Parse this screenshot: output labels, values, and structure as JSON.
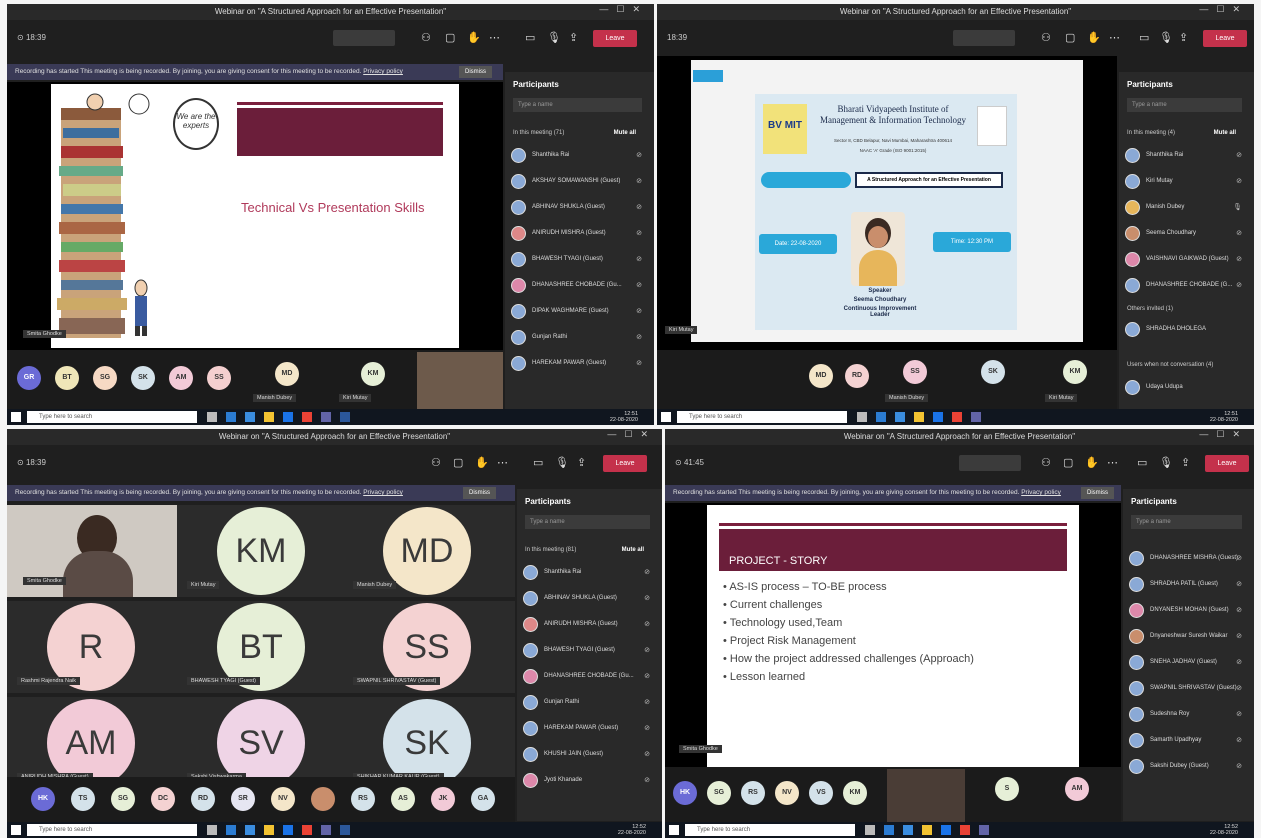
{
  "window_title": "Webinar on \"A Structured Approach for an Effective Presentation\"",
  "toolbar": {
    "leave_label": "Leave",
    "q2_time": "18:39"
  },
  "banner": {
    "text": "Recording has started  This meeting is being recorded. By joining, you are giving consent for this meeting to be recorded.",
    "privacy": "Privacy policy",
    "dismiss": "Dismiss"
  },
  "panel": {
    "title": "Participants",
    "search_placeholder": "Type a name",
    "in_meeting_q1": "In this meeting (71)",
    "in_meeting_q2": "In this meeting (4)",
    "in_meeting_q3": "In this meeting (81)",
    "mute_all": "Mute all",
    "others_invited": "Others invited (1)",
    "not_in_convo": "Users when not conversation (4)"
  },
  "q1": {
    "slide_title": "Technical Vs Presentation Skills",
    "bubble_text": "We are the experts",
    "presenter_tag": "Smita Ghodke",
    "participants": [
      "Shanthika Rai",
      "AKSHAY SOMAWANSHI (Guest)",
      "ABHINAV SHUKLA (Guest)",
      "ANIRUDH MISHRA (Guest)",
      "BHAWESH TYAGI (Guest)",
      "DHANASHREE CHOBADE (Gu...",
      "DIPAK WAGHMARE (Guest)",
      "Gunjan Rathi",
      "HAREKAM PAWAR (Guest)"
    ],
    "avatars": [
      "GR",
      "BT",
      "SG",
      "SK",
      "AM",
      "SS",
      "MD",
      "KM"
    ],
    "avatar_tags": [
      "Manish Dubey",
      "Kiri Mutay"
    ]
  },
  "q2": {
    "college_name": "Bharati Vidyapeeth Institute of Management & Information Technology",
    "college_address": "Sector 8, CBD Belapur, Navi Mumbai, Maharashtra 400614",
    "naac": "NAAC 'A' Grade (ISO 9001:2015)",
    "logo": "BV MIT",
    "webinar_label": "A Structured Approach for an Effective Presentation",
    "date_box": "Date: 22-08-2020",
    "time_box": "Time: 12:30 PM",
    "speaker_label": "Speaker",
    "speaker_name": "Seema Choudhary",
    "speaker_role": "Continuous Improvement Leader",
    "presenter_tag": "Kiri Mutay",
    "participants": [
      "Shanthika Rai",
      "Kiri Mutay",
      "Manish Dubey",
      "Seema Choudhary",
      "VAISHNAVI GAIKWAD (Guest)",
      "DHANASHREE CHOBADE (G..."
    ],
    "invited": [
      "SHRADHA DHOLEGA"
    ],
    "last_row": "Udaya Udupa",
    "avatars": [
      "MD",
      "RD",
      "SS",
      "SK",
      "KM"
    ],
    "avatar_tags": [
      "Manish Dubey",
      "Kiri Mutay"
    ]
  },
  "q3": {
    "tiles": [
      {
        "initials": "KM",
        "tag": "Kiri Mutay"
      },
      {
        "initials": "MD",
        "tag": "Manish Dubey"
      },
      {
        "initials": "R",
        "tag": "Rashmi Rajendra Naik"
      },
      {
        "initials": "BT",
        "tag": "BHAWESH TYAGI (Guest)"
      },
      {
        "initials": "SS",
        "tag": "SWAPNIL SHRIVASTAV (Guest)"
      },
      {
        "initials": "AM",
        "tag": "ANIRUDH MISHRA (Guest)"
      },
      {
        "initials": "SV",
        "tag": "Sakshi Vishwakarma"
      },
      {
        "initials": "SK",
        "tag": "SHIKHAR KUMAR KAUR (Guest)"
      }
    ],
    "video_tag": "Smita Ghodke",
    "participants": [
      "Shanthika Rai",
      "ABHINAV SHUKLA (Guest)",
      "ANIRUDH MISHRA (Guest)",
      "BHAWESH TYAGI (Guest)",
      "DHANASHREE CHOBADE (Gu...",
      "Gunjan Rathi",
      "HAREKAM PAWAR (Guest)",
      "KHUSHI JAIN (Guest)",
      "Jyoti Khanade"
    ],
    "avatars": [
      "HK",
      "TS",
      "SG",
      "DC",
      "RD",
      "SR",
      "NV",
      "",
      "RS",
      "AS",
      "JK",
      "GA"
    ]
  },
  "q4": {
    "time": "41:45",
    "slide_title": "PROJECT - STORY",
    "bullets": [
      "AS-IS process – TO-BE process",
      "Current challenges",
      "Technology used,Team",
      "Project Risk Management",
      "How the project addressed challenges (Approach)",
      "Lesson learned"
    ],
    "presenter_tag": "Smita Ghodke",
    "participants": [
      "DHANASHREE MISHRA (Guest)",
      "SHRADHA PATIL (Guest)",
      "DNYANESH MOHAN (Guest)",
      "Dnyaneshwar Suresh Waikar",
      "SNEHA JADHAV (Guest)",
      "SWAPNIL SHRIVASTAV (Guest)",
      "Sudeshna Roy",
      "Samarth Upadhyay",
      "Sakshi Dubey (Guest)"
    ],
    "avatars": [
      "HK",
      "SG",
      "RS",
      "NV",
      "VS",
      "KM",
      "S",
      "AM"
    ]
  },
  "taskbar": {
    "search": "Type here to search",
    "time1": "12:51",
    "date1": "22-08-2020",
    "time2": "12:52",
    "date2": "22-08-2020"
  }
}
